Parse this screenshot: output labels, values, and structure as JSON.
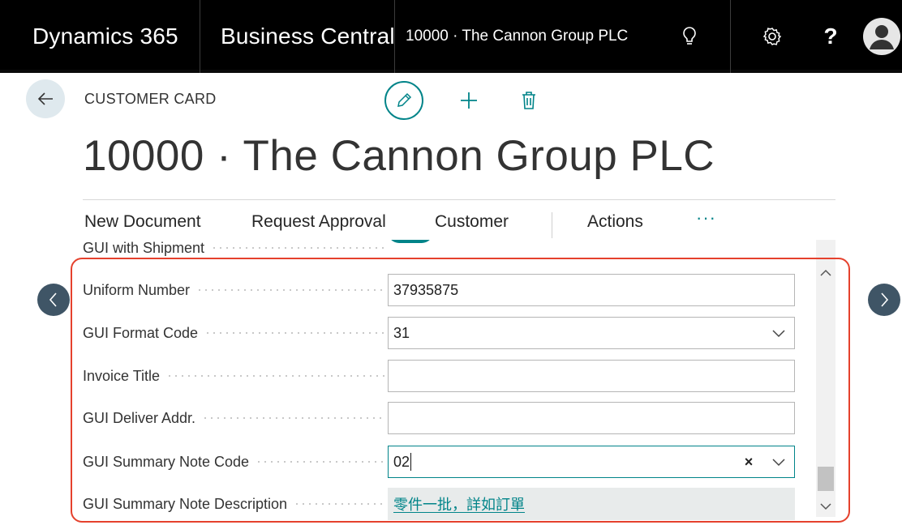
{
  "topbar": {
    "product": "Dynamics 365",
    "app": "Business Central",
    "breadcrumb": "10000 · The Cannon Group PLC",
    "icons": [
      "lightbulb-icon",
      "gear-icon",
      "help-icon",
      "avatar"
    ],
    "help_glyph": "?"
  },
  "header": {
    "caption": "CUSTOMER CARD",
    "title": "10000 · The Cannon Group PLC",
    "actions": [
      "edit-icon",
      "add-icon",
      "delete-icon"
    ]
  },
  "actionbar": {
    "new_document": "New Document",
    "request_approval": "Request Approval",
    "customer": "Customer",
    "actions": "Actions",
    "more": "···"
  },
  "fields": {
    "gui_with_shipment": {
      "label": "GUI with Shipment",
      "value": true
    },
    "uniform_number": {
      "label": "Uniform Number",
      "value": "37935875"
    },
    "gui_format_code": {
      "label": "GUI Format Code",
      "value": "31"
    },
    "invoice_title": {
      "label": "Invoice Title",
      "value": ""
    },
    "gui_deliver_addr": {
      "label": "GUI Deliver Addr.",
      "value": ""
    },
    "gui_summary_note_code": {
      "label": "GUI Summary Note Code",
      "value": "02",
      "clear": "×"
    },
    "gui_summary_note_description": {
      "label": "GUI Summary Note Description",
      "value": "零件一批，詳如訂單"
    }
  },
  "colors": {
    "accent": "#008489",
    "topbar": "#000000",
    "highlight": "#e5412d",
    "nav_arrow": "#3f5566"
  }
}
